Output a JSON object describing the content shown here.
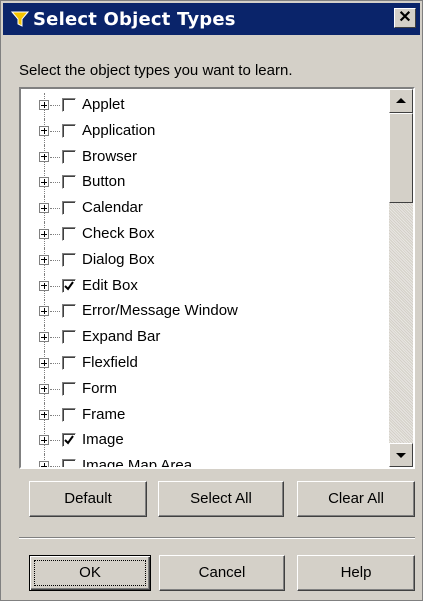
{
  "window": {
    "title": "Select Object Types",
    "close_glyph": "✕"
  },
  "instruction": "Select the object types you want to learn.",
  "tree": {
    "items": [
      {
        "label": "Applet",
        "checked": false
      },
      {
        "label": "Application",
        "checked": false
      },
      {
        "label": "Browser",
        "checked": false
      },
      {
        "label": "Button",
        "checked": false
      },
      {
        "label": "Calendar",
        "checked": false
      },
      {
        "label": "Check Box",
        "checked": false
      },
      {
        "label": "Dialog Box",
        "checked": false
      },
      {
        "label": "Edit Box",
        "checked": true
      },
      {
        "label": "Error/Message Window",
        "checked": false
      },
      {
        "label": "Expand Bar",
        "checked": false
      },
      {
        "label": "Flexfield",
        "checked": false
      },
      {
        "label": "Form",
        "checked": false
      },
      {
        "label": "Frame",
        "checked": false
      },
      {
        "label": "Image",
        "checked": true
      },
      {
        "label": "Image Map Area",
        "checked": false
      }
    ]
  },
  "buttons": {
    "default_label": "Default",
    "select_all_label": "Select All",
    "clear_all_label": "Clear All",
    "ok_label": "OK",
    "cancel_label": "Cancel",
    "help_label": "Help"
  },
  "icons": {
    "title_icon": "filter-funnel-icon",
    "expander": "plus-expander-icon",
    "check": "checkmark-icon"
  },
  "colors": {
    "titlebar": "#0a246a",
    "face": "#d4d0c8",
    "funnel": "#f5c400"
  }
}
